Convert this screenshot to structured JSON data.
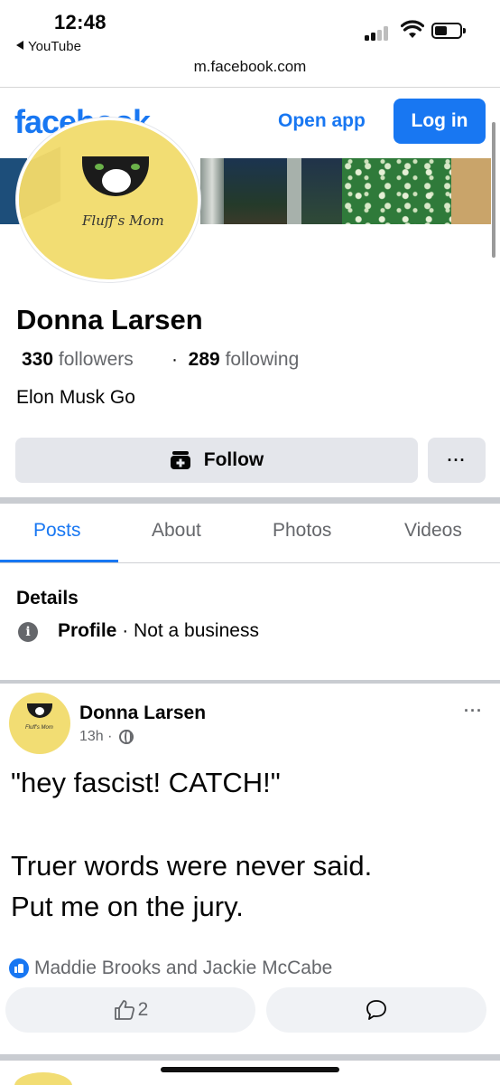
{
  "status_bar": {
    "time": "12:48",
    "back_app": "YouTube"
  },
  "browser": {
    "url": "m.facebook.com"
  },
  "header": {
    "logo": "facebook",
    "open_app": "Open app",
    "login": "Log in"
  },
  "profile": {
    "name": "Donna Larsen",
    "avatar_text": "Fluff's Mom",
    "followers_count": "330",
    "followers_label": "followers",
    "following_count": "289",
    "following_label": "following",
    "bio": "Elon Musk Go",
    "follow_label": "Follow",
    "more_label": "···"
  },
  "tabs": [
    {
      "label": "Posts"
    },
    {
      "label": "About"
    },
    {
      "label": "Photos"
    },
    {
      "label": "Videos"
    }
  ],
  "details": {
    "title": "Details",
    "row_key": "Profile",
    "row_sep": " · ",
    "row_value": "Not a business"
  },
  "post": {
    "author": "Donna Larsen",
    "avatar_text": "Fluff's Mom",
    "time": "13h",
    "meta_sep": "·",
    "more": "···",
    "lines": [
      "\"hey fascist! CATCH!\"",
      "Truer words were never said.",
      "Put me on the jury."
    ],
    "reactions_text": "Maddie Brooks and Jackie McCabe",
    "like_count": "2"
  },
  "colors": {
    "brand": "#1877f2",
    "button_gray": "#e4e6eb",
    "secondary_text": "#65676b"
  },
  "icons": {
    "follow": "user-plus-icon",
    "info": "info-icon",
    "globe": "globe-icon",
    "like": "thumbs-up-icon",
    "comment": "comment-icon"
  }
}
